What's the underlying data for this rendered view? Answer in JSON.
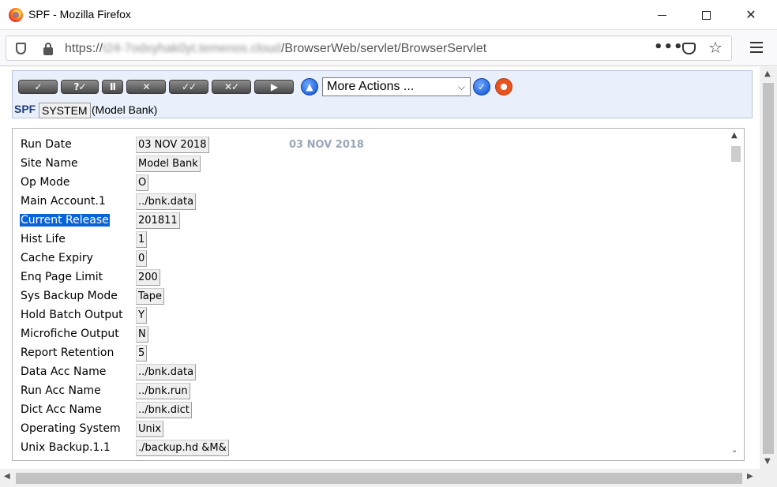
{
  "window": {
    "title": "SPF - Mozilla Firefox"
  },
  "address_bar": {
    "scheme": "https://",
    "host": "t24-7odxyhak0yt.temenos.cloud",
    "path": "/BrowserWeb/servlet/BrowserServlet"
  },
  "toolbar": {
    "buttons": [
      {
        "name": "commit-button",
        "glyph": "✓"
      },
      {
        "name": "validate-button",
        "glyph": "?✓"
      },
      {
        "name": "hold-button",
        "glyph": "II"
      },
      {
        "name": "delete-button",
        "glyph": "✕"
      },
      {
        "name": "authorise-button",
        "glyph": "✓✓"
      },
      {
        "name": "reverse-button",
        "glyph": "✕✓"
      },
      {
        "name": "next-button",
        "glyph": "▶"
      }
    ],
    "more_actions_label": "More Actions ..."
  },
  "context": {
    "app": "SPF",
    "record_id": "SYSTEM",
    "company": "(Model Bank)"
  },
  "form": {
    "side_date": "03 NOV 2018",
    "fields": [
      {
        "label": "Run Date",
        "value": "03 NOV 2018"
      },
      {
        "label": "Site Name",
        "value": "Model Bank"
      },
      {
        "label": "Op Mode",
        "value": "O"
      },
      {
        "label": "Main Account.1",
        "value": "../bnk.data"
      },
      {
        "label": "Current Release",
        "value": "201811",
        "selected": true
      },
      {
        "label": "Hist Life",
        "value": "1"
      },
      {
        "label": "Cache Expiry",
        "value": "0"
      },
      {
        "label": "Enq Page Limit",
        "value": "200"
      },
      {
        "label": "Sys Backup Mode",
        "value": "Tape"
      },
      {
        "label": "Hold Batch Output",
        "value": "Y"
      },
      {
        "label": "Microfiche Output",
        "value": "N"
      },
      {
        "label": "Report Retention",
        "value": "5"
      },
      {
        "label": "Data Acc Name",
        "value": "../bnk.data"
      },
      {
        "label": "Run Acc Name",
        "value": "../bnk.run"
      },
      {
        "label": "Dict Acc Name",
        "value": "../bnk.dict"
      },
      {
        "label": "Operating System",
        "value": "Unix"
      },
      {
        "label": "Unix Backup.1.1",
        "value": "./backup.hd &M&"
      }
    ]
  }
}
